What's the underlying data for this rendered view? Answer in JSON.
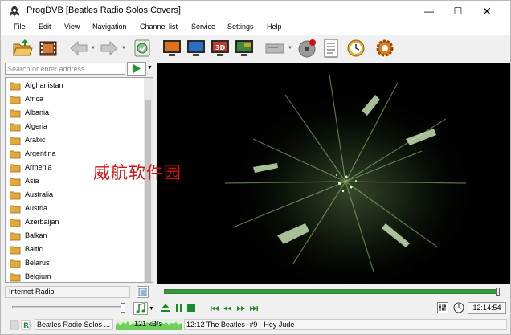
{
  "window": {
    "title": "ProgDVB [Beatles Radio Solos Covers]",
    "controls": {
      "minimize": "—",
      "maximize": "☐",
      "close": "✕"
    }
  },
  "menu": [
    "File",
    "Edit",
    "View",
    "Navigation",
    "Channel list",
    "Service",
    "Settings",
    "Help"
  ],
  "toolbar": {
    "icons": [
      "open-folder-icon",
      "film-icon",
      "back-arrow-icon",
      "forward-arrow-icon",
      "clean-icon",
      "tv-screen-icon",
      "tv-screen-blue-icon",
      "3d-icon",
      "picture-in-picture-icon",
      "device-icon",
      "record-disc-icon",
      "epg-icon",
      "clock-icon",
      "gear-icon"
    ]
  },
  "search": {
    "placeholder": "Search or enter address"
  },
  "channel_list": {
    "items": [
      "Afghanistan",
      "Africa",
      "Albania",
      "Algeria",
      "Arabic",
      "Argentina",
      "Armenia",
      "Asia",
      "Australia",
      "Austria",
      "Azerbaijan",
      "Balkan",
      "Baltic",
      "Belarus",
      "Belgium"
    ]
  },
  "group": {
    "label": "Internet Radio"
  },
  "playback": {
    "progress": 0.99,
    "volume": 0.96
  },
  "clock": {
    "time": "12:14:54"
  },
  "status": {
    "channel": "Beatles Radio Solos ...",
    "rate": "121 kB/s",
    "track": "12:12 The  Beatles -#9 - Hey Jude"
  },
  "watermark": "威航软件园",
  "colors": {
    "accent_green": "#2f9e3a",
    "video_bg": "#000000",
    "folder": "#e2a93b",
    "watermark": "#d21212"
  }
}
